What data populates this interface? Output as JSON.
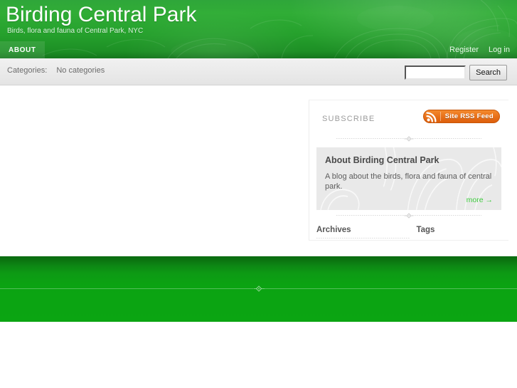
{
  "site": {
    "title": "Birding Central Park",
    "tagline": "Birds, flora and fauna of Central Park, NYC"
  },
  "nav": {
    "primary": [
      {
        "label": "ABOUT",
        "name": "nav-item-about"
      }
    ],
    "account": [
      {
        "label": "Register",
        "name": "nav-link-register"
      },
      {
        "label": "Log in",
        "name": "nav-link-login"
      }
    ]
  },
  "subbar": {
    "categories_label": "Categories:",
    "categories_value": "No categories",
    "search": {
      "value": "",
      "placeholder": "",
      "button_label": "Search"
    }
  },
  "sidebar": {
    "subscribe_label": "SUBSCRIBE",
    "rss": {
      "label": "Site RSS Feed",
      "icon": "rss-icon"
    },
    "about": {
      "title": "About Birding Central Park",
      "text": "A blog about the birds, flora and fauna of central park.",
      "more_label": "more →"
    },
    "columns": [
      {
        "title": "Archives",
        "items": []
      },
      {
        "title": "Tags",
        "items": []
      }
    ]
  },
  "colors": {
    "header_green": "#25a02c",
    "footer_green": "#0ba512",
    "rss_orange": "#e8711a",
    "link_green": "#3ecb3e",
    "subbar_gray": "#eaeaea"
  }
}
